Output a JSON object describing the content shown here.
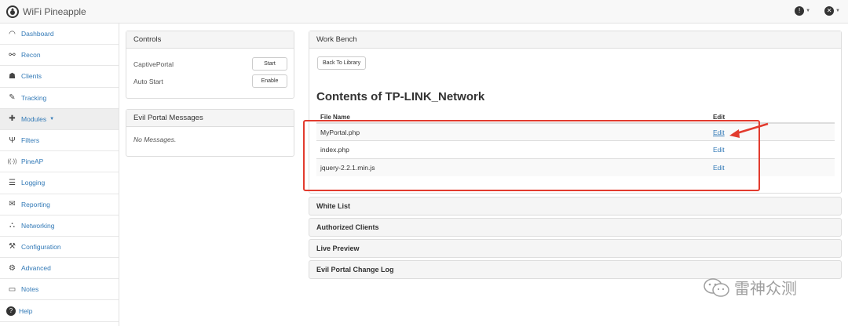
{
  "app": {
    "title": "WiFi Pineapple"
  },
  "sidebar": {
    "items": [
      {
        "label": "Dashboard",
        "icon": "dashboard-icon",
        "glyph": "◠"
      },
      {
        "label": "Recon",
        "icon": "binoculars-icon",
        "glyph": "⚲"
      },
      {
        "label": "Clients",
        "icon": "users-icon",
        "glyph": "👥"
      },
      {
        "label": "Tracking",
        "icon": "tracking-icon",
        "glyph": "✎"
      },
      {
        "label": "Modules",
        "icon": "puzzle-icon",
        "glyph": "✚"
      },
      {
        "label": "Filters",
        "icon": "filter-icon",
        "glyph": "Ψ"
      },
      {
        "label": "PineAP",
        "icon": "broadcast-icon",
        "glyph": "((·))"
      },
      {
        "label": "Logging",
        "icon": "log-icon",
        "glyph": "☰"
      },
      {
        "label": "Reporting",
        "icon": "reporting-icon",
        "glyph": "✉"
      },
      {
        "label": "Networking",
        "icon": "network-icon",
        "glyph": "⛬"
      },
      {
        "label": "Configuration",
        "icon": "wrench-icon",
        "glyph": "⚒"
      },
      {
        "label": "Advanced",
        "icon": "gears-icon",
        "glyph": "⚙"
      },
      {
        "label": "Notes",
        "icon": "notes-icon",
        "glyph": "▭"
      },
      {
        "label": "Help",
        "icon": "help-icon",
        "glyph": "?"
      }
    ]
  },
  "controls": {
    "title": "Controls",
    "rows": [
      {
        "label": "CaptivePortal",
        "button": "Start"
      },
      {
        "label": "Auto Start",
        "button": "Enable"
      }
    ]
  },
  "messages": {
    "title": "Evil Portal Messages",
    "empty": "No Messages."
  },
  "workbench": {
    "title": "Work Bench",
    "back_button": "Back To Library",
    "heading": "Contents of TP-LINK_Network",
    "columns": [
      "File Name",
      "Edit"
    ],
    "files": [
      {
        "name": "MyPortal.php",
        "edit": "Edit"
      },
      {
        "name": "index.php",
        "edit": "Edit"
      },
      {
        "name": "jquery-2.2.1.min.js",
        "edit": "Edit"
      }
    ]
  },
  "sections": [
    "White List",
    "Authorized Clients",
    "Live Preview",
    "Evil Portal Change Log"
  ],
  "annotation_color": "#e23b2e",
  "link_color": "#337ab7",
  "watermark": "雷神众测"
}
